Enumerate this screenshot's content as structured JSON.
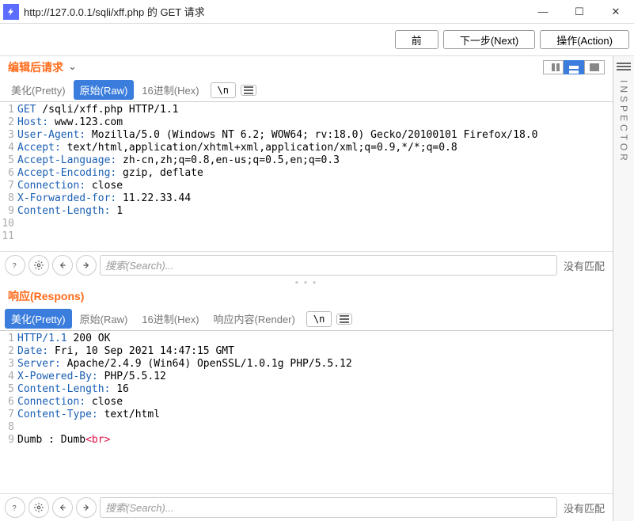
{
  "window": {
    "title": "http://127.0.0.1/sqli/xff.php 的 GET 请求",
    "min": "—",
    "max": "☐",
    "close": "✕"
  },
  "toolbar": {
    "prev": "前",
    "next": "下一步(Next)",
    "action": "操作(Action)"
  },
  "request": {
    "title": "编辑后请求",
    "caret": "⌄",
    "tabs": {
      "pretty": "美化(Pretty)",
      "raw": "原始(Raw)",
      "hex": "16进制(Hex)",
      "n": "\\n"
    },
    "lines": [
      {
        "pre": "",
        "key": "GET",
        "rest": " /sqli/xff.php HTTP/1.1"
      },
      {
        "pre": "",
        "key": "Host:",
        "rest": " www.123.com"
      },
      {
        "pre": "",
        "key": "User-Agent:",
        "rest": " Mozilla/5.0 (Windows NT 6.2; WOW64; rv:18.0) Gecko/20100101 Firefox/18.0"
      },
      {
        "pre": "",
        "key": "Accept:",
        "rest": " text/html,application/xhtml+xml,application/xml;q=0.9,*/*;q=0.8"
      },
      {
        "pre": "",
        "key": "Accept-Language:",
        "rest": " zh-cn,zh;q=0.8,en-us;q=0.5,en;q=0.3"
      },
      {
        "pre": "",
        "key": "Accept-Encoding:",
        "rest": " gzip, deflate"
      },
      {
        "pre": "",
        "key": "Connection:",
        "rest": " close"
      },
      {
        "pre": "",
        "key": "X-Forwarded-for:",
        "rest": " 11.22.33.44"
      },
      {
        "pre": "",
        "key": "Content-Length:",
        "rest": " 1"
      },
      {
        "pre": "",
        "key": "",
        "rest": ""
      },
      {
        "pre": "",
        "key": "",
        "rest": ""
      }
    ],
    "search_ph": "搜索(Search)...",
    "no_match": "没有匹配"
  },
  "response": {
    "title": "响应(Respons)",
    "tabs": {
      "pretty": "美化(Pretty)",
      "raw": "原始(Raw)",
      "hex": "16进制(Hex)",
      "render": "响应内容(Render)",
      "n": "\\n"
    },
    "lines": [
      {
        "pre": "",
        "key": "HTTP/1.1",
        "rest": " 200 OK"
      },
      {
        "pre": "",
        "key": "Date:",
        "rest": " Fri, 10 Sep 2021 14:47:15 GMT"
      },
      {
        "pre": "",
        "key": "Server:",
        "rest": " Apache/2.4.9 (Win64) OpenSSL/1.0.1g PHP/5.5.12"
      },
      {
        "pre": "",
        "key": "X-Powered-By:",
        "rest": " PHP/5.5.12"
      },
      {
        "pre": "",
        "key": "Content-Length:",
        "rest": " 16"
      },
      {
        "pre": "",
        "key": "Connection:",
        "rest": " close"
      },
      {
        "pre": "",
        "key": "Content-Type:",
        "rest": " text/html"
      },
      {
        "pre": "",
        "key": "",
        "rest": ""
      },
      {
        "pre": "Dumb : Dumb",
        "key": "",
        "rest": "",
        "tag": "<br>"
      }
    ],
    "search_ph": "搜索(Search)...",
    "no_match": "没有匹配"
  },
  "inspector": {
    "label": "INSPECTOR"
  }
}
